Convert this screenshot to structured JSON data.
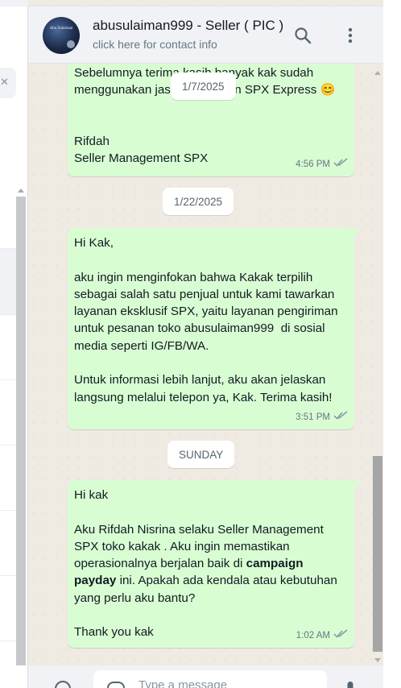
{
  "header": {
    "title": "abusulaiman999 - Seller ( PIC )",
    "subtitle": "click here for contact info",
    "avatar_text": "Abu Sulaiman"
  },
  "messages": [
    {
      "text": "Sebelumnya terima kasih banyak kak sudah menggunakan jasa pengiriman SPX Express 😊\n\n\nRifdah\nSeller Management SPX",
      "time": "4:56 PM"
    },
    {
      "text": "Hi Kak,\n\naku ingin menginfokan bahwa Kakak terpilih sebagai salah satu penjual untuk kami tawarkan layanan eksklusif SPX, yaitu layanan pengiriman untuk pesanan toko abusulaiman999  di sosial media seperti IG/FB/WA.\n\nUntuk informasi lebih lanjut, aku akan jelaskan langsung melalui telepon ya, Kak. Terima kasih!",
      "time": "3:51 PM"
    },
    {
      "text_before": "Hi kak\n\nAku Rifdah Nisrina selaku Seller Management SPX toko kakak . Aku ingin memastikan operasionalnya berjalan baik di ",
      "bold": "campaign payday",
      "text_after": " ini. Apakah ada kendala atau kebutuhan yang perlu aku bantu?\n\nThank you kak",
      "time": "1:02 AM"
    }
  ],
  "dates": {
    "floating": "1/7/2025",
    "d1": "1/22/2025",
    "d2": "SUNDAY"
  },
  "composer": {
    "placeholder": "Type a message"
  },
  "icons": {
    "search": "search-icon",
    "menu": "kebab-menu-icon",
    "read": "double-check-icon",
    "emoji": "emoji-icon",
    "mic": "mic-icon"
  },
  "colors": {
    "bubble_out": "#d9fdd3",
    "chat_bg": "#efeae2",
    "header_bg": "#f0f2f5",
    "read_tick": "#8696a0"
  }
}
